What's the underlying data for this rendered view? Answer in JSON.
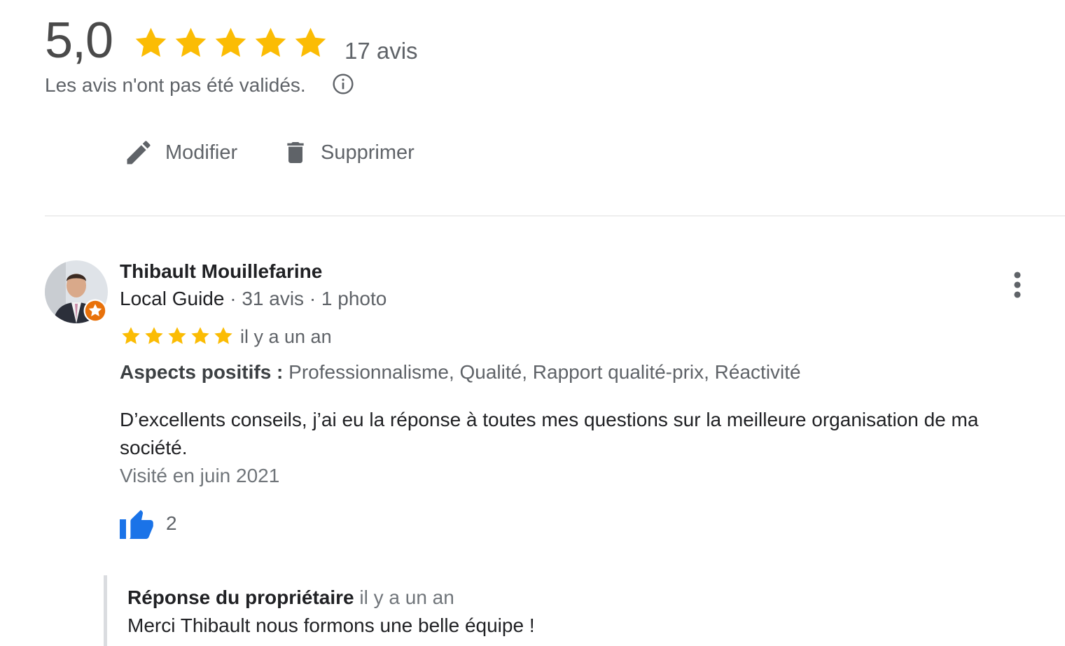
{
  "summary": {
    "rating": "5,0",
    "stars": 5,
    "review_count": "17 avis",
    "disclaimer": "Les avis n'ont pas été validés.",
    "info_icon": "info-icon"
  },
  "actions": {
    "edit_label": "Modifier",
    "edit_icon": "pencil-icon",
    "delete_label": "Supprimer",
    "delete_icon": "trash-icon"
  },
  "review": {
    "author": "Thibault Mouillefarine",
    "author_level": "Local Guide",
    "author_stats": " · 31 avis · 1 photo",
    "stars": 5,
    "time": "il y a un an",
    "aspects_label": "Aspects positifs :",
    "aspects_values": " Professionnalisme, Qualité, Rapport qualité-prix, Réactivité",
    "text": "D’excellents conseils, j’ai eu la réponse à toutes mes questions sur la meilleure organisation de ma société.",
    "visited": "Visité en juin 2021",
    "likes": "2",
    "like_icon": "thumbs-up-icon",
    "more_icon": "more-vert-icon"
  },
  "owner_reply": {
    "label": "Réponse du propriétaire",
    "time": "il y a un an",
    "text": "Merci Thibault nous formons une belle équipe !"
  },
  "colors": {
    "star": "#fbbc04",
    "accent_blue": "#1a73e8",
    "text_secondary": "#5f6368",
    "badge_orange": "#e8710a"
  }
}
